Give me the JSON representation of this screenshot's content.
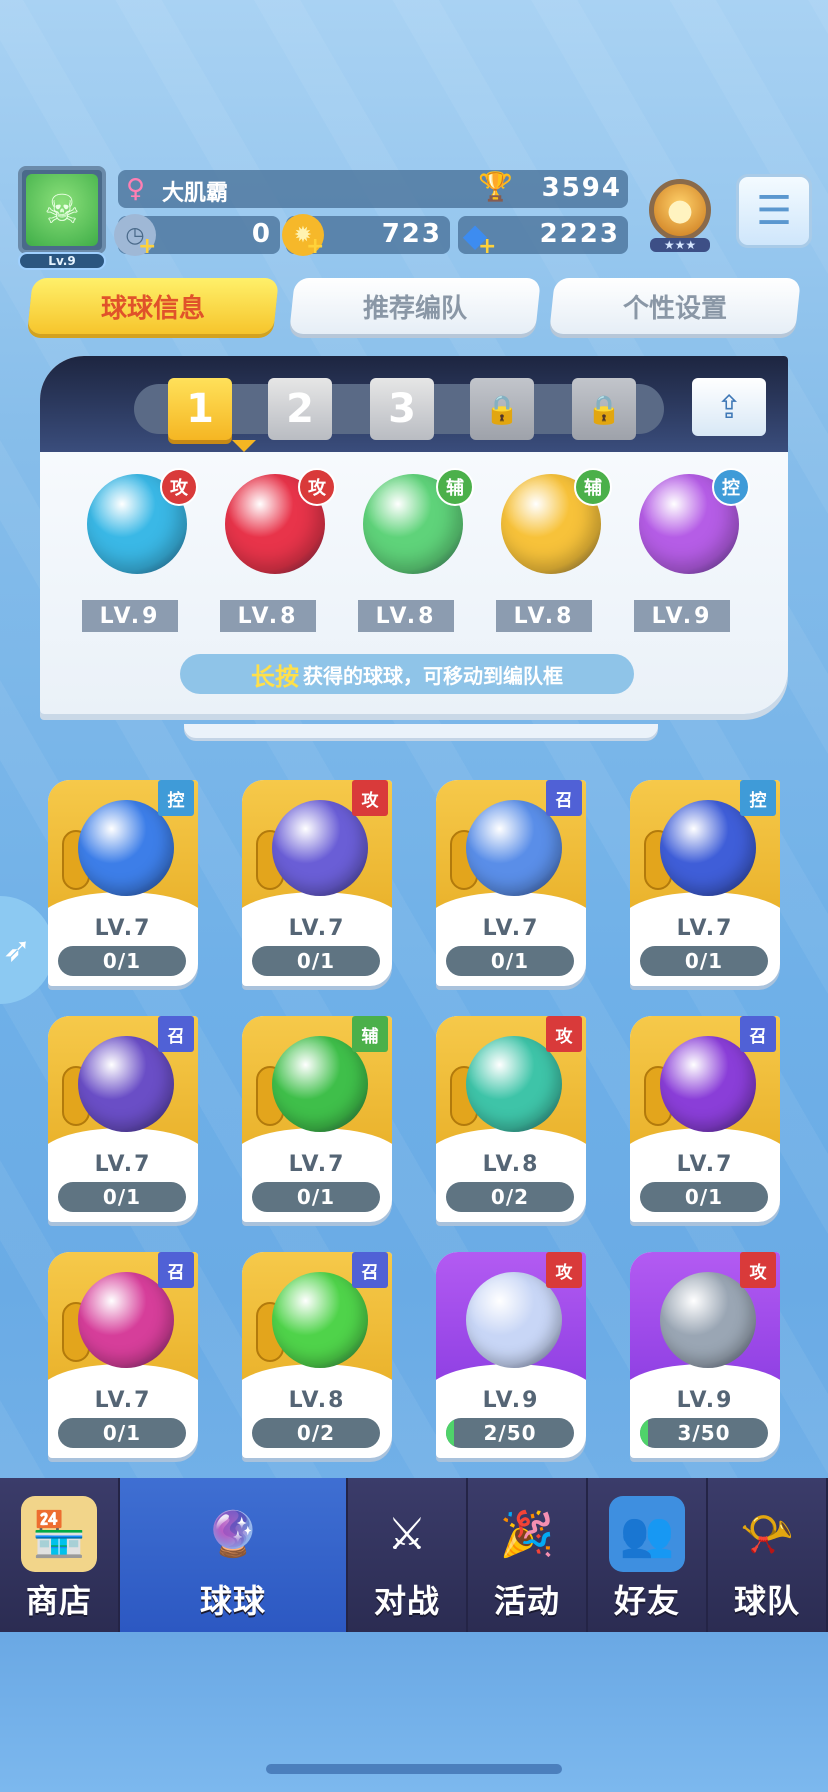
{
  "player": {
    "level_badge": "Lv.9",
    "name": "大肌霸",
    "trophies": "3594"
  },
  "resources": [
    {
      "name": "stamina",
      "value": "0",
      "icon": "clock-coin-icon",
      "color": "#9fb8d6"
    },
    {
      "name": "gold",
      "value": "723",
      "icon": "gold-coin-icon",
      "color": "#f6b82a"
    },
    {
      "name": "diamond",
      "value": "2223",
      "icon": "diamond-icon",
      "color": "#3d8cf0"
    }
  ],
  "tabs": [
    {
      "label": "球球信息",
      "active": true
    },
    {
      "label": "推荐编队",
      "active": false
    },
    {
      "label": "个性设置",
      "active": false
    }
  ],
  "team_slots": [
    {
      "label": "1",
      "state": "active"
    },
    {
      "label": "2",
      "state": "off"
    },
    {
      "label": "3",
      "state": "off"
    },
    {
      "label": "",
      "state": "locked",
      "icon": "lock-icon"
    },
    {
      "label": "",
      "state": "locked",
      "icon": "lock-icon"
    }
  ],
  "team": [
    {
      "tag": "攻",
      "tag_type": "atk",
      "level": "LV.9",
      "orb": "swirl",
      "color": "#3ab8e6"
    },
    {
      "tag": "攻",
      "tag_type": "atk",
      "level": "LV.8",
      "orb": "lightning",
      "color": "#e8344a"
    },
    {
      "tag": "辅",
      "tag_type": "sup",
      "level": "LV.8",
      "orb": "sp",
      "color": "#5fd37a"
    },
    {
      "tag": "辅",
      "tag_type": "sup",
      "level": "LV.8",
      "orb": "pumpkin",
      "color": "#f7c23a"
    },
    {
      "tag": "控",
      "tag_type": "ctl",
      "level": "LV.9",
      "orb": "cloud",
      "color": "#b55de6"
    }
  ],
  "hint": {
    "highlight": "长按",
    "text": "获得的球球，可移动到编队框"
  },
  "collection": [
    {
      "tag": "控",
      "tag_type": "ctl",
      "level": "LV.7",
      "count": "0/1",
      "progress": 0,
      "color": "#3d7ee8",
      "card": "gold"
    },
    {
      "tag": "攻",
      "tag_type": "atk",
      "level": "LV.7",
      "count": "0/1",
      "progress": 0,
      "color": "#6a5ed6",
      "card": "gold"
    },
    {
      "tag": "召",
      "tag_type": "sum",
      "level": "LV.7",
      "count": "0/1",
      "progress": 0,
      "color": "#5a8ee8",
      "card": "gold"
    },
    {
      "tag": "控",
      "tag_type": "ctl",
      "level": "LV.7",
      "count": "0/1",
      "progress": 0,
      "color": "#3f5ed8",
      "card": "gold"
    },
    {
      "tag": "召",
      "tag_type": "sum",
      "level": "LV.7",
      "count": "0/1",
      "progress": 0,
      "color": "#6a4ec6",
      "card": "gold"
    },
    {
      "tag": "辅",
      "tag_type": "sup",
      "level": "LV.7",
      "count": "0/1",
      "progress": 0,
      "color": "#3fbf4a",
      "card": "gold"
    },
    {
      "tag": "攻",
      "tag_type": "atk",
      "level": "LV.8",
      "count": "0/2",
      "progress": 0,
      "color": "#3ec4a8",
      "card": "gold"
    },
    {
      "tag": "召",
      "tag_type": "sum",
      "level": "LV.7",
      "count": "0/1",
      "progress": 0,
      "color": "#8a3ed8",
      "card": "gold"
    },
    {
      "tag": "召",
      "tag_type": "sum",
      "level": "LV.7",
      "count": "0/1",
      "progress": 0,
      "color": "#d63e9a",
      "card": "gold"
    },
    {
      "tag": "召",
      "tag_type": "sum",
      "level": "LV.8",
      "count": "0/2",
      "progress": 0,
      "color": "#4fd34a",
      "card": "gold"
    },
    {
      "tag": "攻",
      "tag_type": "atk",
      "level": "LV.9",
      "count": "2/50",
      "progress": 0.04,
      "color": "#c8d6f6",
      "card": "purple"
    },
    {
      "tag": "攻",
      "tag_type": "atk",
      "level": "LV.9",
      "count": "3/50",
      "progress": 0.06,
      "color": "#9aa6b4",
      "card": "purple"
    }
  ],
  "nav": [
    {
      "label": "商店",
      "icon": "shop-icon",
      "active": false
    },
    {
      "label": "球球",
      "icon": "ball-icon",
      "active": true
    },
    {
      "label": "对战",
      "icon": "crossed-swords-icon",
      "active": false
    },
    {
      "label": "活动",
      "icon": "party-popper-icon",
      "active": false
    },
    {
      "label": "好友",
      "icon": "friends-book-icon",
      "active": false
    },
    {
      "label": "球队",
      "icon": "whistle-icon",
      "active": false
    }
  ],
  "colors": {
    "tag_atk": "#d93a3a",
    "tag_sup": "#4bb04a",
    "tag_ctl": "#3f9bd8",
    "tag_sum": "#5061d6",
    "active_tab": "#f6c52c"
  }
}
